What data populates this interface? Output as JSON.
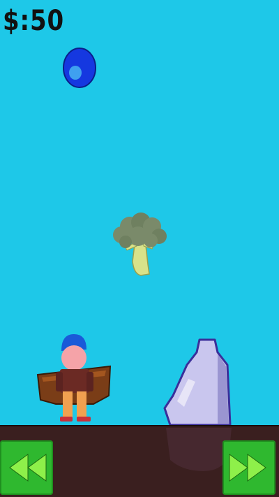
{
  "hud": {
    "score_text": "$:50"
  },
  "controls": {
    "left_icon": "rewind-double-arrow-icon",
    "right_icon": "fast-forward-double-arrow-icon",
    "color": "#2fb82f"
  },
  "scene": {
    "sky_color": "#1ec8e8",
    "ground_color": "#3a1f1f",
    "falling_items": [
      "blue-gem-icon",
      "broccoli-icon"
    ],
    "player": "boy-with-basket-sprite",
    "obstacle": "milk-bottle-icon"
  }
}
